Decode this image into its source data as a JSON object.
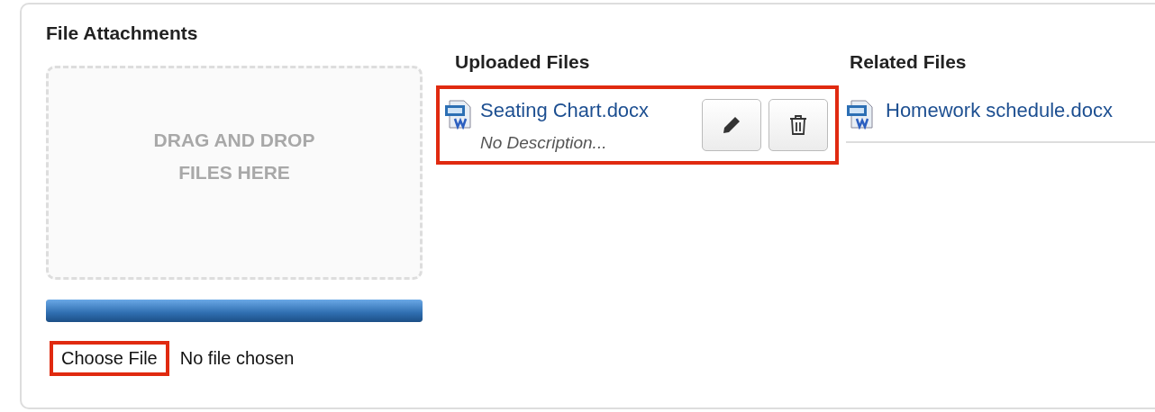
{
  "title": "File Attachments",
  "dropzone": {
    "lines": [
      "DRAG AND DROP",
      "FILES HERE"
    ]
  },
  "upload_progress": {
    "level": 1
  },
  "file_input": {
    "button": "Choose File",
    "status": "No file chosen",
    "highlighted": true
  },
  "uploaded_files": {
    "heading": "Uploaded Files",
    "items": [
      {
        "name": "Seating Chart.docx",
        "description": "No Description...",
        "highlighted": true
      }
    ]
  },
  "related_files": {
    "heading": "Related Files",
    "items": [
      {
        "name": "Homework schedule.docx"
      }
    ]
  }
}
